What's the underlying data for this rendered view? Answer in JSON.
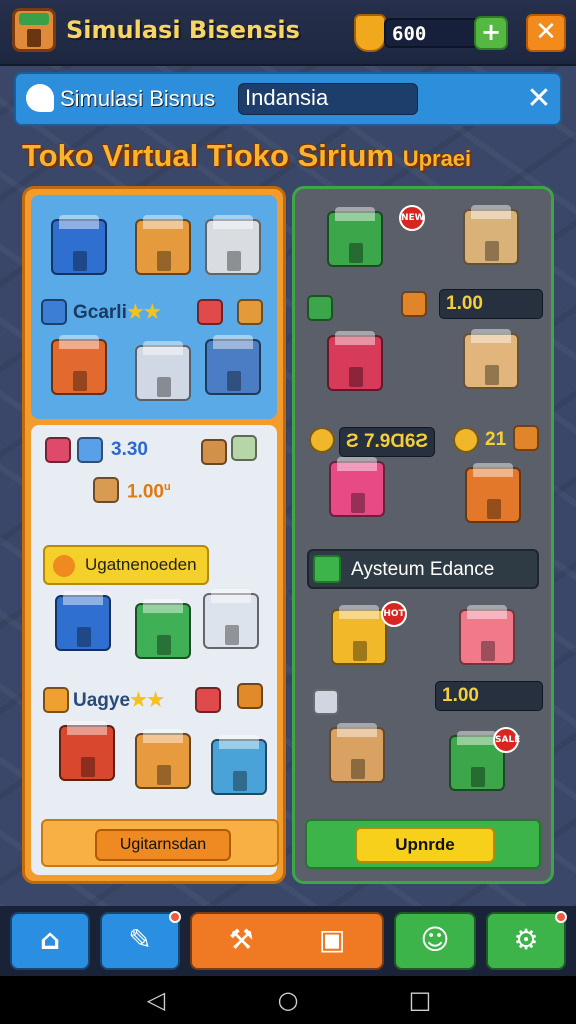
{
  "app": {
    "title": "Simulasi Bisensis",
    "coins": "600",
    "add_coin": "+",
    "close": "✕"
  },
  "header": {
    "label": "Simulasi Bisnus",
    "search_value": "Indansia",
    "close": "✕"
  },
  "page": {
    "title": "Toko Virtual Tioko Sirium",
    "title_suffix": "Upraei"
  },
  "left_panel": {
    "featured_label": "Gcarli",
    "featured_stars": "★★",
    "price_a": "3.30",
    "price_b": "1.00",
    "price_b_suffix": "u",
    "chip_label": "Ugatnenoeden",
    "category_label": "Uagye",
    "category_stars": "★★",
    "action_button": "Ugitarnsdan"
  },
  "right_panel": {
    "price_1": "1.00",
    "price_2": "Ƨ 7.9Ɑ6Ƨ",
    "price_3": "21",
    "chip_label": "Aysteum Edance",
    "price_4": "1.00",
    "upgrade_button": "Upnrde",
    "badges": [
      "NEW",
      "HOT",
      "SALE"
    ]
  },
  "bottom_nav": {
    "items": [
      {
        "icon": "home-icon",
        "color": "#2a8fe0"
      },
      {
        "icon": "edit-icon",
        "color": "#2a8fe0"
      },
      {
        "icon": "tools-icon",
        "color": "#f07a24"
      },
      {
        "icon": "users-icon",
        "color": "#3db44a"
      },
      {
        "icon": "settings-icon",
        "color": "#3db44a"
      }
    ]
  },
  "android_nav": {
    "back": "◁",
    "home": "○",
    "recents": "□"
  }
}
